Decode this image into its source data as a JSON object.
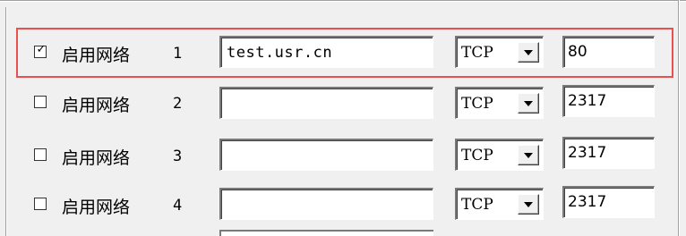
{
  "network_rows": [
    {
      "checked": true,
      "check_glyph": "✓",
      "label": "启用网络",
      "index": "1",
      "host": "test.usr.cn",
      "protocol": "TCP",
      "port": "80"
    },
    {
      "checked": false,
      "check_glyph": "",
      "label": "启用网络",
      "index": "2",
      "host": "",
      "protocol": "TCP",
      "port": "2317"
    },
    {
      "checked": false,
      "check_glyph": "",
      "label": "启用网络",
      "index": "3",
      "host": "",
      "protocol": "TCP",
      "port": "2317"
    },
    {
      "checked": false,
      "check_glyph": "",
      "label": "启用网络",
      "index": "4",
      "host": "",
      "protocol": "TCP",
      "port": "2317"
    }
  ],
  "colors": {
    "highlight_border": "#e95050",
    "window_background": "#f0f0f0"
  }
}
